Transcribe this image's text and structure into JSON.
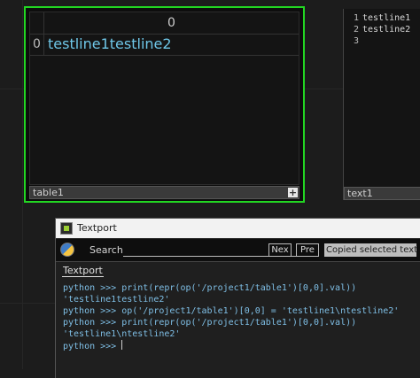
{
  "table_node": {
    "name": "table1",
    "column_header": "0",
    "row_index": "0",
    "cell_value": "testline1testline2",
    "selected_color": "#22d622"
  },
  "text_node": {
    "name": "text1",
    "line_numbers": [
      "1",
      "2",
      "3"
    ],
    "lines": [
      "testline1",
      "testline2",
      ""
    ]
  },
  "textport": {
    "title": "Textport",
    "search_label": "Search",
    "search_value": "",
    "next_label": "Nex",
    "prev_label": "Pre",
    "status": "Copied selected text.",
    "tab_label": "Textport",
    "console_lines": [
      "python >>> print(repr(op('/project1/table1')[0,0].val))",
      "'testline1testline2'",
      "python >>> op('/project1/table1')[0,0] = 'testline1\\ntestline2'",
      "python >>> print(repr(op('/project1/table1')[0,0].val))",
      "'testline1\\ntestline2'",
      "python >>> "
    ]
  }
}
